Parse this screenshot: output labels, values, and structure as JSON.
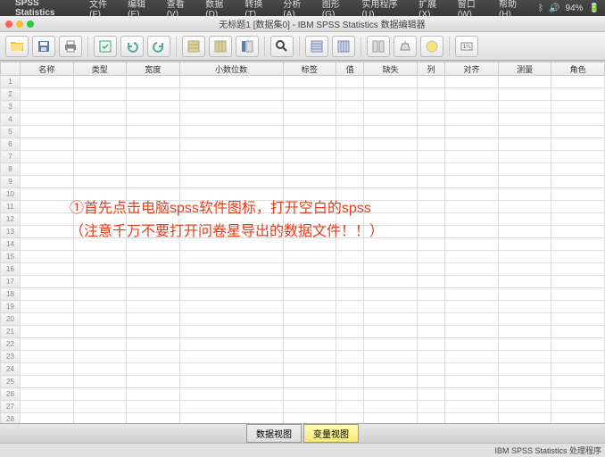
{
  "menubar": {
    "app": "SPSS Statistics",
    "items": [
      "文件(F)",
      "编辑(E)",
      "查看(V)",
      "数据(D)",
      "转换(T)",
      "分析(A)",
      "图形(G)",
      "实用程序(U)",
      "扩展(X)",
      "窗口(W)",
      "帮助(H)"
    ],
    "battery": "94%"
  },
  "window": {
    "title": "无标题1 [数据集0] - IBM SPSS Statistics 数据编辑器"
  },
  "columns": [
    "名称",
    "类型",
    "宽度",
    "小数位数",
    "标签",
    "值",
    "缺失",
    "列",
    "对齐",
    "测量",
    "角色"
  ],
  "rows": 28,
  "annotation": {
    "line1": "①首先点击电脑spss软件图标，打开空白的spss",
    "line2": "（注意千万不要打开问卷星导出的数据文件！！）"
  },
  "tabs": {
    "data": "数据视图",
    "var": "变量视图"
  },
  "status": "IBM SPSS Statistics 处理程序"
}
